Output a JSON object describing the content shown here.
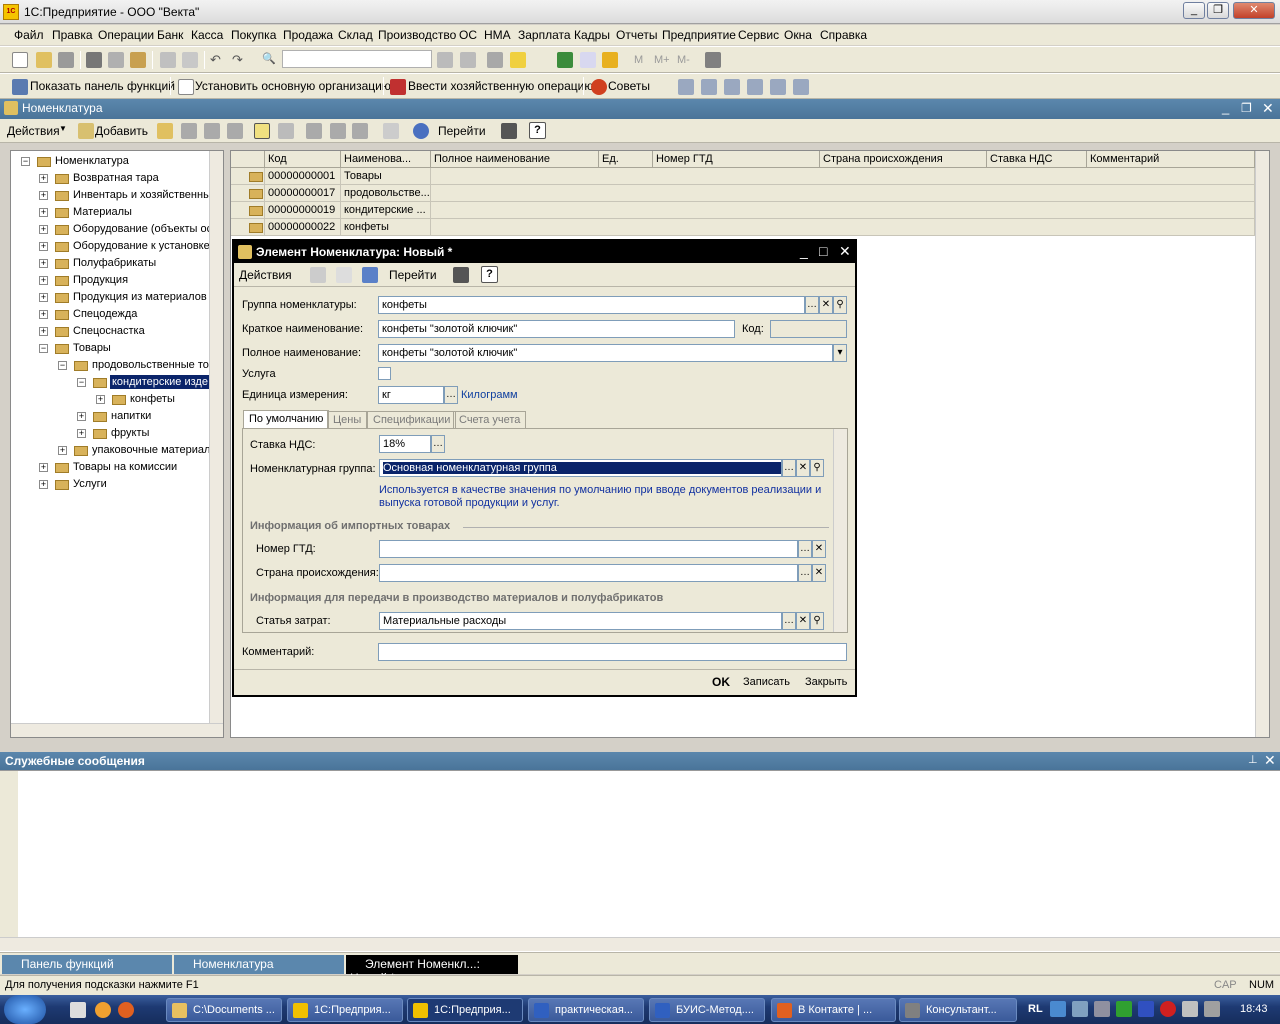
{
  "window": {
    "title": "1С:Предприятие - ООО \"Векта\"",
    "logo_text": "1С"
  },
  "menu": [
    "Файл",
    "Правка",
    "Операции",
    "Банк",
    "Касса",
    "Покупка",
    "Продажа",
    "Склад",
    "Производство",
    "ОС",
    "НМА",
    "Зарплата",
    "Кадры",
    "Отчеты",
    "Предприятие",
    "Сервис",
    "Окна",
    "Справка"
  ],
  "toolbar2": {
    "show_panel": "Показать панель функций",
    "set_org": "Установить основную организацию",
    "enter_op": "Ввести хозяйственную операцию",
    "tips": "Советы",
    "m_buttons": [
      "M",
      "M+",
      "M-"
    ]
  },
  "nom": {
    "title": "Номенклатура",
    "actions": "Действия",
    "add": "Добавить",
    "goto": "Перейти",
    "help": "?",
    "tree": {
      "root": "Номенклатура",
      "items": [
        "Возвратная тара",
        "Инвентарь и хозяйственные",
        "Материалы",
        "Оборудование (объекты осн",
        "Оборудование к установке",
        "Полуфабрикаты",
        "Продукция",
        "Продукция из материалов",
        "Спецодежда",
        "Спецоснастка",
        "Товары"
      ],
      "food": "продовольственные то",
      "confect": "кондитерские изде",
      "candies": "конфеты",
      "drinks": "напитки",
      "fruits": "фрукты",
      "pack": "упаковочные материал",
      "commission": "Товары на комиссии",
      "services": "Услуги"
    },
    "columns": [
      "Код",
      "Наименова...",
      "Полное наименование",
      "Ед.",
      "Номер ГТД",
      "Страна происхождения",
      "Ставка НДС",
      "Комментарий"
    ],
    "rows": [
      {
        "code": "00000000001",
        "name": "Товары"
      },
      {
        "code": "00000000017",
        "name": "продовольстве..."
      },
      {
        "code": "00000000019",
        "name": "кондитерские ..."
      },
      {
        "code": "00000000022",
        "name": "конфеты"
      }
    ]
  },
  "dialog": {
    "title": "Элемент Номенклатура: Новый *",
    "actions": "Действия",
    "goto": "Перейти",
    "help": "?",
    "group_label": "Группа номенклатуры:",
    "group_value": "конфеты",
    "short_label": "Краткое наименование:",
    "short_value": "конфеты \"золотой ключик\"",
    "code_label": "Код:",
    "code_value": "",
    "full_label": "Полное наименование:",
    "full_value": "конфеты \"золотой ключик\"",
    "service_label": "Услуга",
    "unit_label": "Единица измерения:",
    "unit_value": "кг",
    "unit_full": "Килограмм",
    "tabs": [
      "По умолчанию",
      "Цены",
      "Спецификации",
      "Счета учета"
    ],
    "vat_label": "Ставка НДС:",
    "vat_value": "18%",
    "nomgroup_label": "Номенклатурная группа:",
    "nomgroup_value": "Основная номенклатурная группа",
    "hint": "Используется в качестве значения по умолчанию при вводе документов  реализации и выпуска готовой продукции и услуг.",
    "import_header": "Информация об импортных товарах",
    "gtd_label": "Номер ГТД:",
    "country_label": "Страна происхождения:",
    "prod_header": "Информация для передачи в производство материалов и полуфабрикатов",
    "cost_label": "Статья затрат:",
    "cost_value": "Материальные расходы",
    "comment_label": "Комментарий:",
    "ok": "OK",
    "save": "Записать",
    "close": "Закрыть"
  },
  "messages": {
    "title": "Служебные сообщения"
  },
  "wintabs": [
    "Панель функций",
    "Номенклатура",
    "Элемент Номенкл...: Новый *"
  ],
  "status": {
    "hint": "Для получения подсказки нажмите F1",
    "cap": "CAP",
    "num": "NUM"
  },
  "taskbar": {
    "tasks": [
      "C:\\Documents ...",
      "1С:Предприя...",
      "1С:Предприя...",
      "практическая...",
      "БУИС-Метод....",
      "В Контакте | ...",
      "Консультант..."
    ],
    "lang": "RL",
    "clock": "18:43"
  }
}
